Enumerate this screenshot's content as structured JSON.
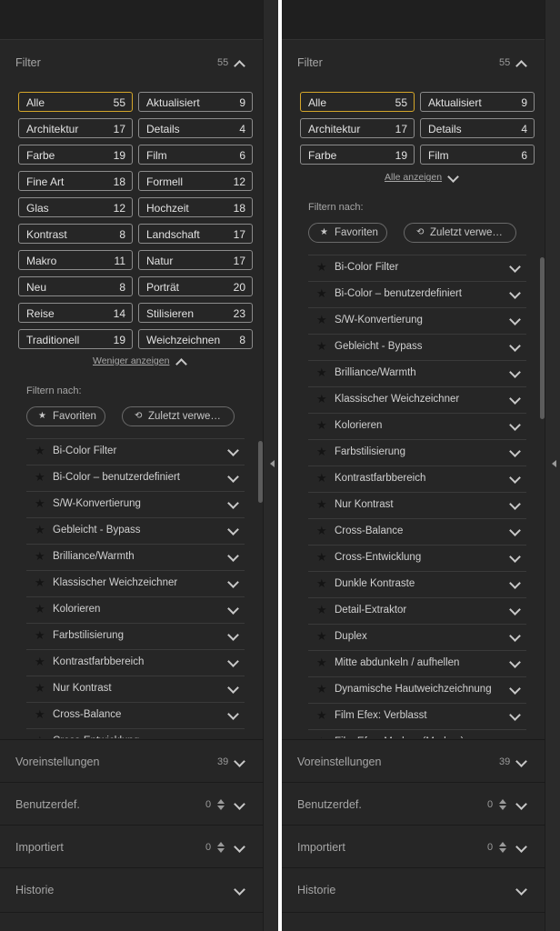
{
  "left": {
    "filter_title": "Filter",
    "filter_count": "55",
    "tags": [
      {
        "name": "Alle",
        "count": "55",
        "active": true
      },
      {
        "name": "Aktualisiert",
        "count": "9"
      },
      {
        "name": "Architektur",
        "count": "17"
      },
      {
        "name": "Details",
        "count": "4"
      },
      {
        "name": "Farbe",
        "count": "19"
      },
      {
        "name": "Film",
        "count": "6"
      },
      {
        "name": "Fine Art",
        "count": "18"
      },
      {
        "name": "Formell",
        "count": "12"
      },
      {
        "name": "Glas",
        "count": "12"
      },
      {
        "name": "Hochzeit",
        "count": "18"
      },
      {
        "name": "Kontrast",
        "count": "8"
      },
      {
        "name": "Landschaft",
        "count": "17"
      },
      {
        "name": "Makro",
        "count": "11"
      },
      {
        "name": "Natur",
        "count": "17"
      },
      {
        "name": "Neu",
        "count": "8"
      },
      {
        "name": "Porträt",
        "count": "20"
      },
      {
        "name": "Reise",
        "count": "14"
      },
      {
        "name": "Stilisieren",
        "count": "23"
      },
      {
        "name": "Traditionell",
        "count": "19"
      },
      {
        "name": "Weichzeichnen",
        "count": "8"
      }
    ],
    "toggle_label": "Weniger anzeigen",
    "filter_by": "Filtern nach:",
    "favorites": "Favoriten",
    "recent": "Zuletzt verwe…",
    "items": [
      "Bi-Color Filter",
      "Bi-Color – benutzerdefiniert",
      "S/W-Konvertierung",
      "Gebleicht - Bypass",
      "Brilliance/Warmth",
      "Klassischer Weichzeichner",
      "Kolorieren",
      "Farbstilisierung",
      "Kontrastfarbbereich",
      "Nur Kontrast",
      "Cross-Balance",
      "Cross-Entwicklung"
    ]
  },
  "right": {
    "filter_title": "Filter",
    "filter_count": "55",
    "tags": [
      {
        "name": "Alle",
        "count": "55",
        "active": true
      },
      {
        "name": "Aktualisiert",
        "count": "9"
      },
      {
        "name": "Architektur",
        "count": "17"
      },
      {
        "name": "Details",
        "count": "4"
      },
      {
        "name": "Farbe",
        "count": "19"
      },
      {
        "name": "Film",
        "count": "6"
      }
    ],
    "toggle_label": "Alle anzeigen",
    "filter_by": "Filtern nach:",
    "favorites": "Favoriten",
    "recent": "Zuletzt verwe…",
    "items": [
      "Bi-Color Filter",
      "Bi-Color – benutzerdefiniert",
      "S/W-Konvertierung",
      "Gebleicht - Bypass",
      "Brilliance/Warmth",
      "Klassischer Weichzeichner",
      "Kolorieren",
      "Farbstilisierung",
      "Kontrastfarbbereich",
      "Nur Kontrast",
      "Cross-Balance",
      "Cross-Entwicklung",
      "Dunkle Kontraste",
      "Detail-Extraktor",
      "Duplex",
      "Mitte abdunkeln / aufhellen",
      "Dynamische Hautweichzeichnung",
      "Film Efex: Verblasst",
      "Film Efex: Modern (Marken)"
    ]
  },
  "sections": {
    "presets": "Voreinstellungen",
    "presets_count": "39",
    "custom": "Benutzerdef.",
    "custom_count": "0",
    "imported": "Importiert",
    "imported_count": "0",
    "history": "Historie"
  },
  "colors": {
    "panel_bg": "#262626",
    "active_border": "#d4a62a",
    "tag_border": "#8c8c8c",
    "text": "#d0d0d0"
  }
}
